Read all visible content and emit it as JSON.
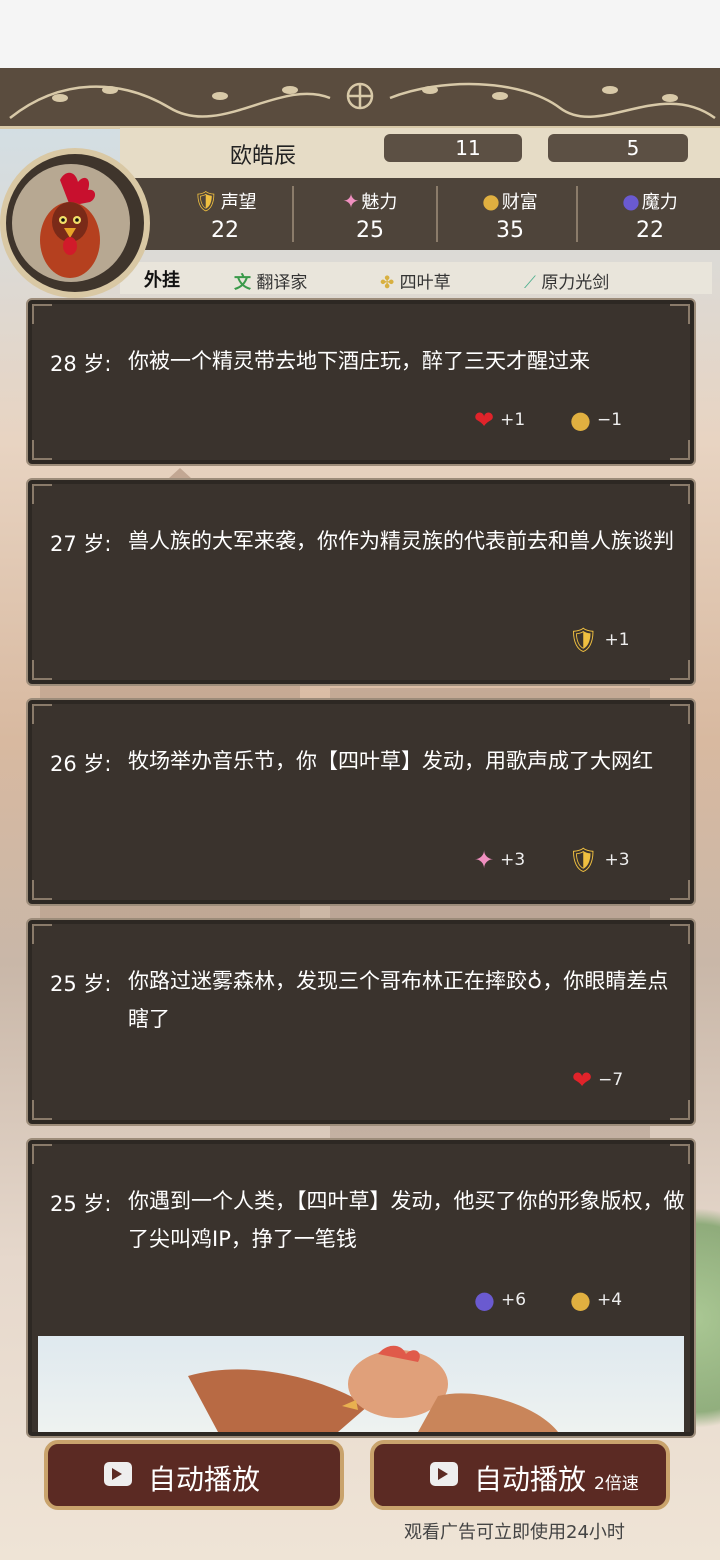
{
  "player": {
    "name": "欧皓辰",
    "combat": "11",
    "hp": "5"
  },
  "stats": [
    {
      "label": "声望",
      "value": "22",
      "icon": "shield-star-icon"
    },
    {
      "label": "魅力",
      "value": "25",
      "icon": "sparkle-icon"
    },
    {
      "label": "财富",
      "value": "35",
      "icon": "coins-icon"
    },
    {
      "label": "魔力",
      "value": "22",
      "icon": "crystal-ball-icon"
    }
  ],
  "buffs": {
    "title": "外挂",
    "items": [
      {
        "label": "翻译家",
        "icon": "translate-icon"
      },
      {
        "label": "四叶草",
        "icon": "clover-icon"
      },
      {
        "label": "原力光剑",
        "icon": "lightsaber-icon"
      }
    ]
  },
  "events": [
    {
      "age": "28 岁:",
      "text": "你被一个精灵带去地下酒庄玩，醉了三天才醒过来",
      "effects": [
        {
          "icon": "heart-icon",
          "value": "+1"
        },
        {
          "icon": "coins-icon",
          "value": "−1"
        }
      ]
    },
    {
      "age": "27 岁:",
      "text": "兽人族的大军来袭，你作为精灵族的代表前去和兽人族谈判",
      "effects": [
        {
          "icon": "shield-star-icon",
          "value": "+1"
        }
      ]
    },
    {
      "age": "26 岁:",
      "text": "牧场举办音乐节，你【四叶草】发动，用歌声成了大网红",
      "effects": [
        {
          "icon": "sparkle-icon",
          "value": "+3"
        },
        {
          "icon": "shield-star-icon",
          "value": "+3"
        }
      ]
    },
    {
      "age": "25 岁:",
      "text": "你路过迷雾森林，发现三个哥布林正在摔跤♁，你眼睛差点瞎了",
      "effects": [
        {
          "icon": "heart-icon",
          "value": "−7"
        }
      ]
    },
    {
      "age": "25 岁:",
      "text": "你遇到一个人类，【四叶草】发动，他买了你的形象版权，做了尖叫鸡IP，挣了一笔钱",
      "effects": [
        {
          "icon": "crystal-ball-icon",
          "value": "+6"
        },
        {
          "icon": "coins-icon",
          "value": "+4"
        }
      ]
    }
  ],
  "buttons": {
    "auto_play": "自动播放",
    "auto_play_fast": "自动播放",
    "speed": "2倍速",
    "ad_note": "观看广告可立即使用24小时"
  }
}
